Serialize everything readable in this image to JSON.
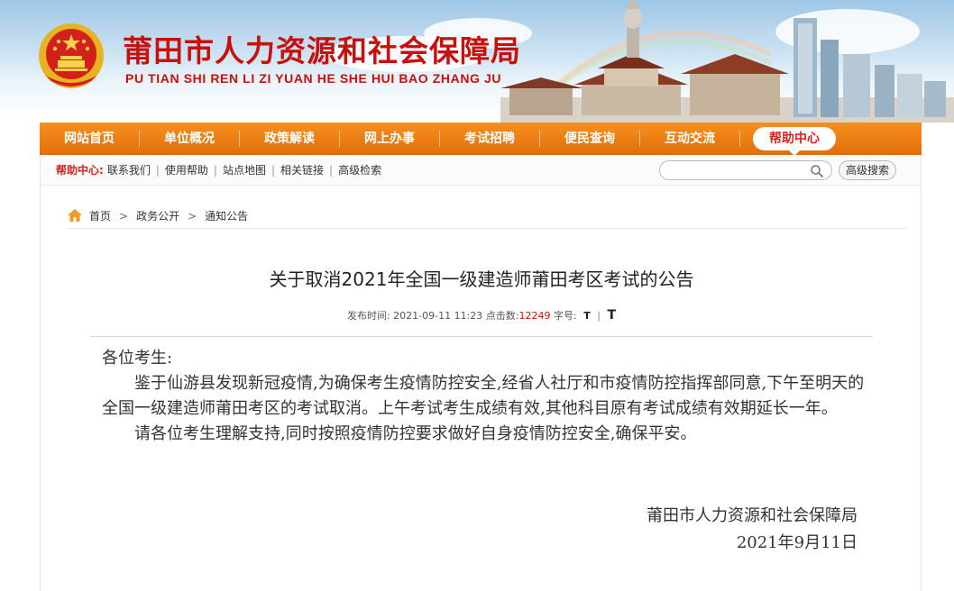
{
  "header": {
    "site_title": "莆田市人力资源和社会保障局",
    "site_subtitle": "PU TIAN SHI REN LI ZI YUAN HE SHE HUI BAO ZHANG JU"
  },
  "nav": {
    "items": [
      {
        "label": "网站首页"
      },
      {
        "label": "单位概况"
      },
      {
        "label": "政策解读"
      },
      {
        "label": "网上办事"
      },
      {
        "label": "考试招聘"
      },
      {
        "label": "便民查询"
      },
      {
        "label": "互动交流"
      },
      {
        "label": "帮助中心"
      }
    ],
    "active_index": 7
  },
  "subbar": {
    "help_label": "帮助中心:",
    "links": [
      "联系我们",
      "使用帮助",
      "站点地图",
      "相关链接",
      "高级检索"
    ],
    "search_placeholder": "",
    "advanced_search_label": "高级搜索"
  },
  "breadcrumb": [
    "首页",
    "政务公开",
    "通知公告"
  ],
  "article": {
    "title": "关于取消2021年全国一级建造师莆田考区考试的公告",
    "publish_label": "发布时间:",
    "publish_time": "2021-09-11 11:23",
    "clicks_label": "点击数:",
    "clicks": "12249",
    "font_label": "字号:",
    "font_small": "T",
    "font_large": "T",
    "greeting": "各位考生:",
    "paragraphs": [
      "鉴于仙游县发现新冠疫情,为确保考生疫情防控安全,经省人社厅和市疫情防控指挥部同意,下午至明天的全国一级建造师莆田考区的考试取消。上午考试考生成绩有效,其他科目原有考试成绩有效期延长一年。",
      "请各位考生理解支持,同时按照疫情防控要求做好自身疫情防控安全,确保平安。"
    ],
    "signature": "莆田市人力资源和社会保障局",
    "date": "2021年9月11日"
  },
  "colors": {
    "brand_red": "#c8100c",
    "nav_orange": "#e36c0a"
  }
}
